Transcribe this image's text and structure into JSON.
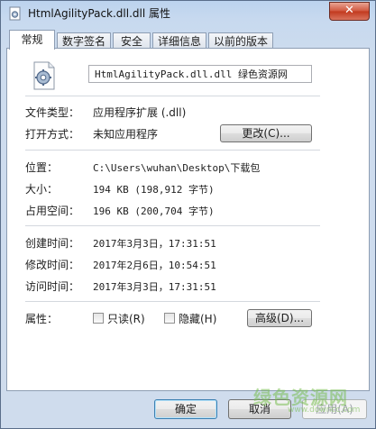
{
  "window": {
    "title": "HtmlAgilityPack.dll.dll 属性",
    "close_glyph": "✕"
  },
  "tabs": [
    {
      "label": "常规",
      "active": true
    },
    {
      "label": "数字签名"
    },
    {
      "label": "安全"
    },
    {
      "label": "详细信息"
    },
    {
      "label": "以前的版本"
    }
  ],
  "general": {
    "file_name": "HtmlAgilityPack.dll.dll 绿色资源网",
    "file_type_label": "文件类型：",
    "file_type_value": "应用程序扩展 (.dll)",
    "open_with_label": "打开方式：",
    "open_with_value": "未知应用程序",
    "change_button": "更改(C)...",
    "location_label": "位置：",
    "location_value": "C:\\Users\\wuhan\\Desktop\\下载包",
    "size_label": "大小：",
    "size_value": "194 KB (198,912 字节)",
    "size_on_disk_label": "占用空间：",
    "size_on_disk_value": "196 KB (200,704 字节)",
    "created_label": "创建时间：",
    "created_value": "2017年3月3日，17:31:51",
    "modified_label": "修改时间：",
    "modified_value": "2017年2月6日，10:54:51",
    "accessed_label": "访问时间：",
    "accessed_value": "2017年3月3日，17:31:51",
    "attributes_label": "属性：",
    "readonly_label": "只读(R)",
    "hidden_label": "隐藏(H)",
    "advanced_button": "高级(D)..."
  },
  "footer": {
    "ok_button": "确定",
    "cancel_button": "取消",
    "apply_button": "应用(A)"
  },
  "watermark": {
    "text": "绿色资源网",
    "url": "www.downcc.com"
  },
  "icons": {
    "title": "dll-file-icon",
    "file": "gear-file-icon"
  }
}
